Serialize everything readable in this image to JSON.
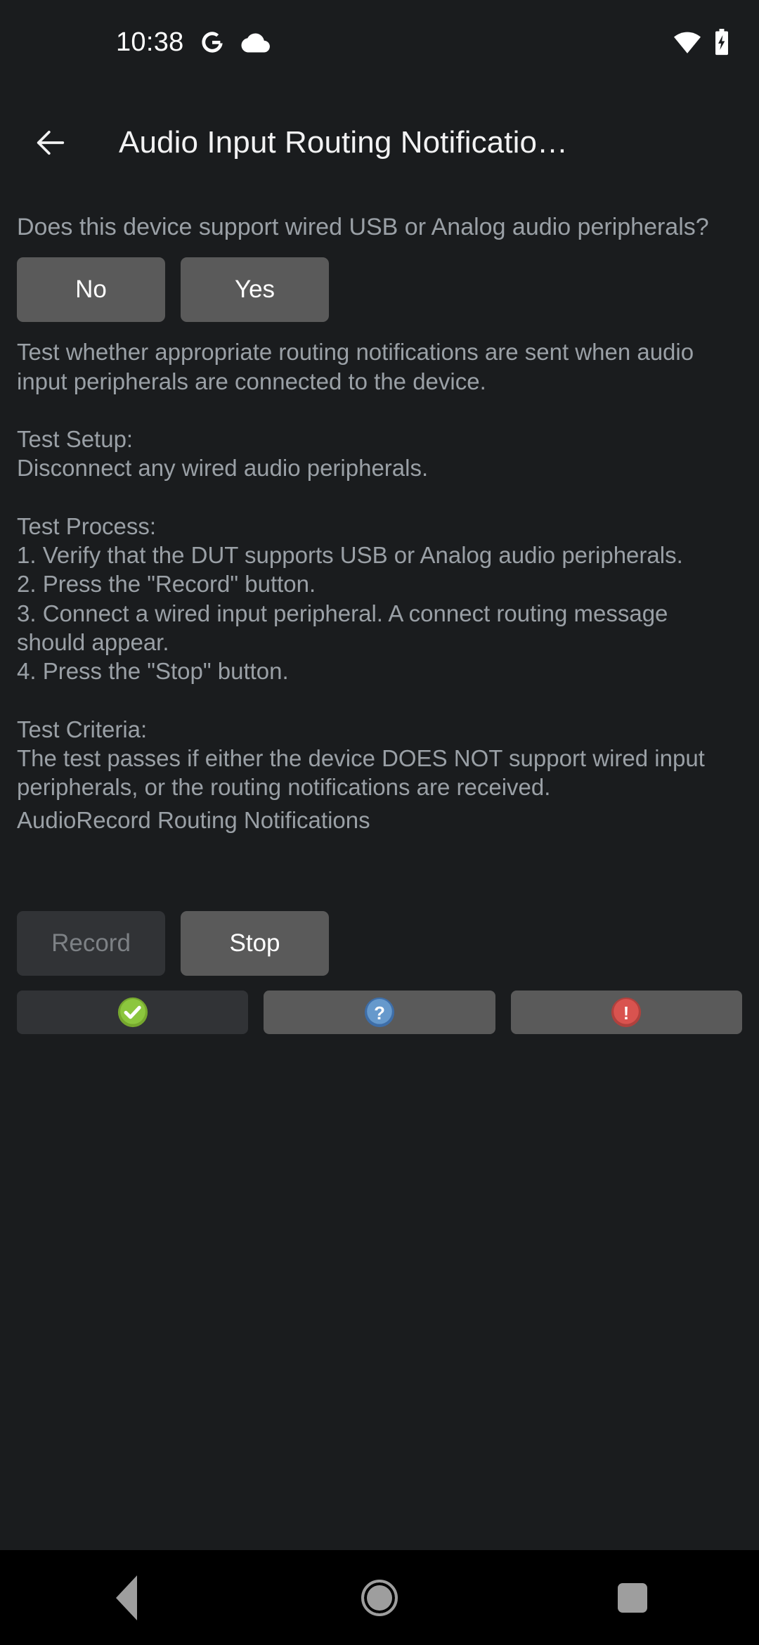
{
  "status_bar": {
    "clock": "10:38",
    "icons": [
      "google-g-icon",
      "cloud-icon"
    ],
    "right_icons": [
      "wifi-icon",
      "battery-charging-icon"
    ]
  },
  "app_bar": {
    "back_label": "back-arrow-icon",
    "title": "Audio Input Routing Notificatio…"
  },
  "main": {
    "question": "Does this device support wired USB or Analog audio peripherals?",
    "answer_buttons": [
      {
        "label": "No",
        "name": "no-button",
        "disabled": false
      },
      {
        "label": "Yes",
        "name": "yes-button",
        "disabled": false
      }
    ],
    "instructions": "Test whether appropriate routing notifications are sent when audio input peripherals are connected to the device.\n\nTest Setup:\nDisconnect any wired audio peripherals.\n\nTest Process:\n1. Verify that the DUT supports USB or Analog audio peripherals.\n2. Press the \"Record\" button.\n3. Connect a wired input peripheral. A connect routing message should appear.\n4. Press the \"Stop\" button.\n\nTest Criteria:\nThe test passes if either the device DOES NOT support wired input peripherals, or the routing notifications are received.",
    "status_line": "AudioRecord Routing Notifications",
    "transport_buttons": [
      {
        "label": "Record",
        "name": "record-button",
        "disabled": true
      },
      {
        "label": "Stop",
        "name": "stop-button",
        "disabled": false
      }
    ],
    "verdict_buttons": [
      {
        "icon": "pass-check-icon",
        "name": "pass-button",
        "color": "#8cc63e",
        "disabled": true
      },
      {
        "icon": "info-question-icon",
        "name": "info-button",
        "color": "#5f93cc",
        "disabled": false
      },
      {
        "icon": "fail-exclamation-icon",
        "name": "fail-button",
        "color": "#d9534f",
        "disabled": false
      }
    ]
  },
  "nav_bar": {
    "items": [
      {
        "name": "nav-back-button",
        "icon": "triangle-back-icon"
      },
      {
        "name": "nav-home-button",
        "icon": "circle-home-icon"
      },
      {
        "name": "nav-recents-button",
        "icon": "square-recents-icon"
      }
    ]
  },
  "colors": {
    "background": "#1a1c1e",
    "button": "#5a5a5a",
    "button_disabled": "#313336",
    "text_primary": "#f2f2f3",
    "text_secondary": "#9aa0a6",
    "nav_bar": "#000000"
  }
}
